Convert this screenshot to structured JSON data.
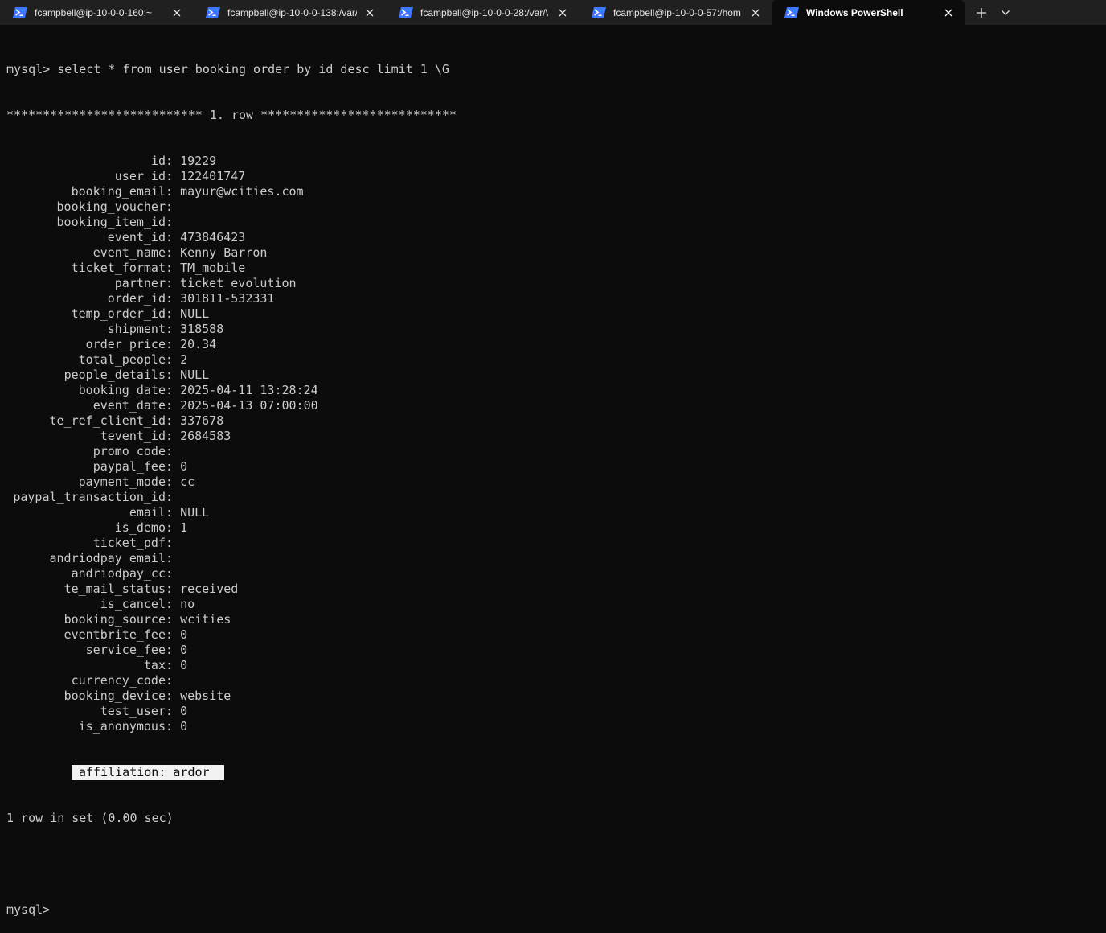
{
  "tabs": [
    {
      "title": "fcampbell@ip-10-0-0-160:~",
      "active": false
    },
    {
      "title": "fcampbell@ip-10-0-0-138:/var/",
      "active": false
    },
    {
      "title": "fcampbell@ip-10-0-0-28:/var/\\",
      "active": false
    },
    {
      "title": "fcampbell@ip-10-0-0-57:/hom",
      "active": false
    },
    {
      "title": "Windows PowerShell",
      "active": true
    }
  ],
  "terminal": {
    "command": "mysql> select * from user_booking order by id desc limit 1 \\G",
    "row_header": "*************************** 1. row ***************************",
    "fields": [
      {
        "key": "id",
        "value": "19229"
      },
      {
        "key": "user_id",
        "value": "122401747"
      },
      {
        "key": "booking_email",
        "value": "mayur@wcities.com"
      },
      {
        "key": "booking_voucher",
        "value": ""
      },
      {
        "key": "booking_item_id",
        "value": ""
      },
      {
        "key": "event_id",
        "value": "473846423"
      },
      {
        "key": "event_name",
        "value": "Kenny Barron"
      },
      {
        "key": "ticket_format",
        "value": "TM_mobile"
      },
      {
        "key": "partner",
        "value": "ticket_evolution"
      },
      {
        "key": "order_id",
        "value": "301811-532331"
      },
      {
        "key": "temp_order_id",
        "value": "NULL"
      },
      {
        "key": "shipment",
        "value": "318588"
      },
      {
        "key": "order_price",
        "value": "20.34"
      },
      {
        "key": "total_people",
        "value": "2"
      },
      {
        "key": "people_details",
        "value": "NULL"
      },
      {
        "key": "booking_date",
        "value": "2025-04-11 13:28:24"
      },
      {
        "key": "event_date",
        "value": "2025-04-13 07:00:00"
      },
      {
        "key": "te_ref_client_id",
        "value": "337678"
      },
      {
        "key": "tevent_id",
        "value": "2684583"
      },
      {
        "key": "promo_code",
        "value": ""
      },
      {
        "key": "paypal_fee",
        "value": "0"
      },
      {
        "key": "payment_mode",
        "value": "cc"
      },
      {
        "key": "paypal_transaction_id",
        "value": ""
      },
      {
        "key": "email",
        "value": "NULL"
      },
      {
        "key": "is_demo",
        "value": "1"
      },
      {
        "key": "ticket_pdf",
        "value": ""
      },
      {
        "key": "andriodpay_email",
        "value": ""
      },
      {
        "key": "andriodpay_cc",
        "value": ""
      },
      {
        "key": "te_mail_status",
        "value": "received"
      },
      {
        "key": "is_cancel",
        "value": "no"
      },
      {
        "key": "booking_source",
        "value": "wcities"
      },
      {
        "key": "eventbrite_fee",
        "value": "0"
      },
      {
        "key": "service_fee",
        "value": "0"
      },
      {
        "key": "tax",
        "value": "0"
      },
      {
        "key": "currency_code",
        "value": ""
      },
      {
        "key": "booking_device",
        "value": "website"
      },
      {
        "key": "test_user",
        "value": "0"
      },
      {
        "key": "is_anonymous",
        "value": "0"
      }
    ],
    "highlighted_field": {
      "key": "affiliation",
      "value": "ardor"
    },
    "summary": "1 row in set (0.00 sec)",
    "prompt": "mysql>"
  },
  "colors": {
    "background": "#0c0c0c",
    "tabbar": "#202020",
    "text": "#cccccc",
    "icon_accent": "#3b78ff"
  },
  "icons": {
    "tab": "powershell-icon",
    "close": "close-icon",
    "new_tab": "plus-icon",
    "dropdown": "chevron-down-icon"
  }
}
